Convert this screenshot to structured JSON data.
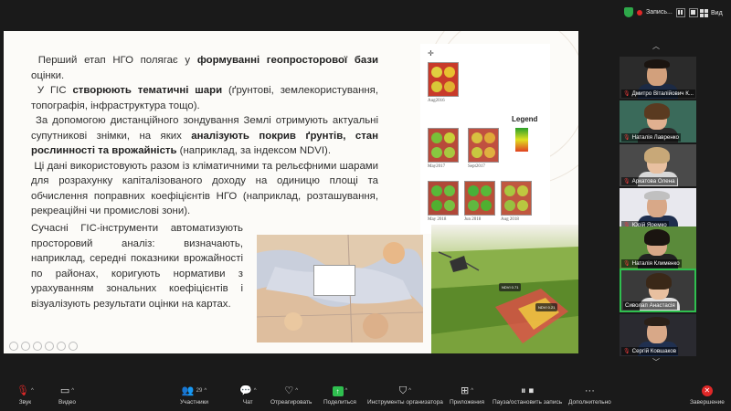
{
  "meeting": {
    "recording_label": "Запись...",
    "view_label": "Вид"
  },
  "slide": {
    "paragraphs": [
      {
        "pre": "Перший етап НГО полягає у ",
        "bold": "формуванні геопросторової бази",
        "post": " оцінки."
      },
      {
        "pre": "У ГІС ",
        "bold": "створюють тематичні шари",
        "post": " (ґрунтові, землекористування, топографія, інфраструктура тощо)."
      },
      {
        "pre": "За допомогою дистанційного зондування Землі отримують актуальні супутникові знімки, на яких ",
        "bold": "аналізують покрив ґрунтів, стан рослинності та врожайність",
        "post": " (наприклад, за індексом NDVI)."
      },
      {
        "pre": "Ці дані використовують разом із кліматичними та рельєфними шарами для розрахунку капіталізованого доходу на одиницю площі та обчислення поправних коефіцієнтів НГО (наприклад, розташування, рекреаційні чи промислові зони).",
        "bold": "",
        "post": ""
      }
    ],
    "paragraph5": "Сучасні ГІС-інструменти автоматизують просторовий аналіз: визначають, наприклад, середні показники врожайності по районах, коригують нормативи з урахуванням зональних коефіцієнтів і візуалізують результати оцінки на картах.",
    "ndvi_figure": {
      "legend_label": "Legend",
      "dates": [
        "Aug2016",
        "May2017",
        "Sept2017",
        "May 2018",
        "Jun 2018",
        "Aug 2018"
      ]
    },
    "field_tags": [
      "NDVI 0.71",
      "NDVI 0.21"
    ]
  },
  "participants": [
    {
      "name": "Дмитро Віталійович К...",
      "muted": true
    },
    {
      "name": "Наталія Лавренко",
      "muted": true
    },
    {
      "name": "Аркатова Олена",
      "muted": true
    },
    {
      "name": "Юрій Яремко",
      "muted": true
    },
    {
      "name": "Наталія Клименко",
      "muted": true
    },
    {
      "name": "Сиволап Анастасія",
      "muted": false
    },
    {
      "name": "Сергій Ковшаков",
      "muted": true
    }
  ],
  "toolbar": {
    "audio": "Звук",
    "video": "Видео",
    "participants": "Участники",
    "participants_count": "29",
    "chat": "Чат",
    "react": "Отреагировать",
    "share": "Поделиться",
    "host_tools": "Инструменты организатора",
    "apps": "Приложения",
    "pause_stop": "Пауза/остановить запись",
    "more": "Дополнительно",
    "end": "Завершение"
  },
  "colors": {
    "accent_green": "#2fbf4f",
    "end_red": "#e02828"
  }
}
